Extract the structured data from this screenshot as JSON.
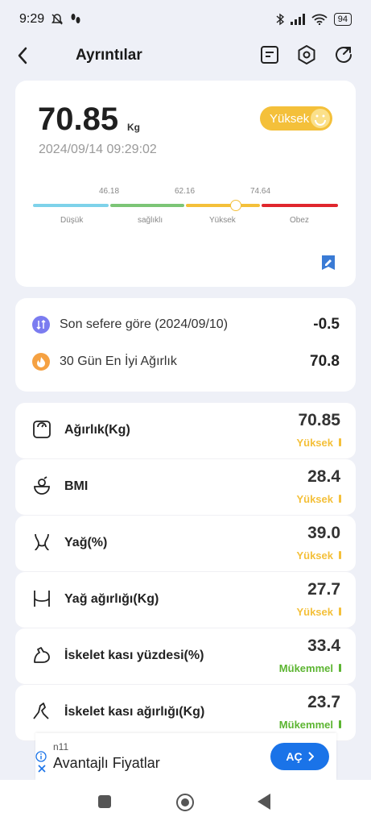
{
  "status_bar": {
    "time": "9:29",
    "battery": "94"
  },
  "header": {
    "title": "Ayrıntılar"
  },
  "summary": {
    "weight": "70.85",
    "unit": "Kg",
    "datetime": "2024/09/14 09:29:02",
    "status": "Yüksek",
    "status_color": "#f4c03a",
    "thresholds": [
      "46.18",
      "62.16",
      "74.64"
    ],
    "segments": [
      {
        "label": "Düşük",
        "color": "#7ed2ea"
      },
      {
        "label": "sağlıklı",
        "color": "#7cc576"
      },
      {
        "label": "Yüksek",
        "color": "#f4c03a"
      },
      {
        "label": "Obez",
        "color": "#e0262d"
      }
    ],
    "marker_level_kg": 70.85
  },
  "comparison": [
    {
      "label": "Son sefere göre (2024/09/10)",
      "value": "-0.5",
      "icon": "compare-icon",
      "icon_color": "#7b7cf0"
    },
    {
      "label": "30 Gün En İyi Ağırlık",
      "value": "70.8",
      "icon": "fire-icon",
      "icon_color": "#f5a142"
    }
  ],
  "metrics": [
    {
      "name": "Ağırlık(Kg)",
      "value": "70.85",
      "status": "Yüksek",
      "status_color": "#f4c03a",
      "icon": "scale-icon"
    },
    {
      "name": "BMI",
      "value": "28.4",
      "status": "Yüksek",
      "status_color": "#f4c03a",
      "icon": "bmi-icon"
    },
    {
      "name": "Yağ(%)",
      "value": "39.0",
      "status": "Yüksek",
      "status_color": "#f4c03a",
      "icon": "body-fat-icon"
    },
    {
      "name": "Yağ ağırlığı(Kg)",
      "value": "27.7",
      "status": "Yüksek",
      "status_color": "#f4c03a",
      "icon": "fat-weight-icon"
    },
    {
      "name": "İskelet kası yüzdesi(%)",
      "value": "33.4",
      "status": "Mükemmel",
      "status_color": "#5cb531",
      "icon": "muscle-icon"
    },
    {
      "name": "İskelet kası ağırlığı(Kg)",
      "value": "23.7",
      "status": "Mükemmel",
      "status_color": "#5cb531",
      "icon": "muscle-weight-icon"
    }
  ],
  "ad": {
    "source": "n11",
    "text": "Avantajlı Fiyatlar",
    "button": "AÇ"
  }
}
